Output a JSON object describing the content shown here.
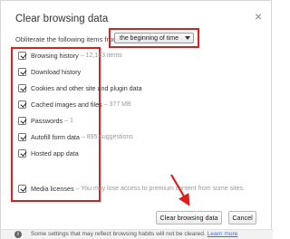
{
  "dialog": {
    "title": "Clear browsing data",
    "close_icon": "close-icon",
    "obliterate_label": "Obliterate the following items from:",
    "time_range": {
      "selected": "the beginning of time",
      "icon": "chevron-down-icon"
    },
    "items": [
      {
        "label": "Browsing history",
        "note": "– 12,183 items",
        "checked": true
      },
      {
        "label": "Download history",
        "note": "",
        "checked": true
      },
      {
        "label": "Cookies and other site and plugin data",
        "note": "",
        "checked": true
      },
      {
        "label": "Cached images and files",
        "note": "– 377 MB",
        "checked": true
      },
      {
        "label": "Passwords",
        "note": "– 1",
        "checked": true
      },
      {
        "label": "Autofill form data",
        "note": "– 895 suggestions",
        "checked": true
      },
      {
        "label": "Hosted app data",
        "note": "",
        "checked": true
      },
      {
        "label": "Media licenses",
        "note": "– You may lose access to premium content from some sites.",
        "checked": true
      }
    ],
    "buttons": {
      "clear": "Clear browsing data",
      "cancel": "Cancel"
    },
    "footer": {
      "icon": "info-icon",
      "text": "Some settings that may reflect browsing habits will not be cleared.",
      "link": "Learn more"
    },
    "colors": {
      "highlight": "#e01d1d",
      "link": "#3b6fd6"
    }
  }
}
